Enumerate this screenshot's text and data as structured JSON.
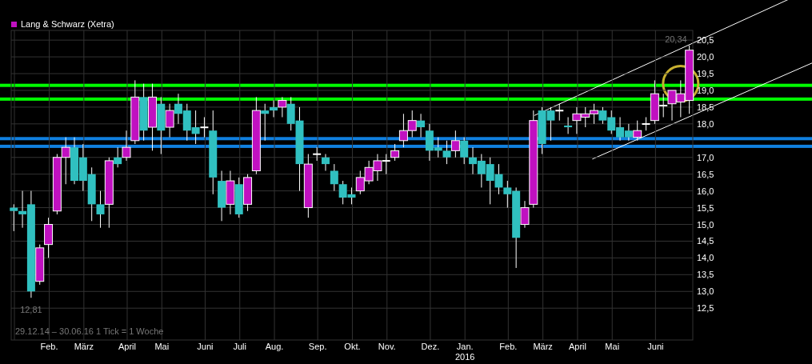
{
  "chart_data": {
    "type": "candlestick",
    "categories": [
      null,
      null,
      null,
      null,
      "Feb.",
      null,
      null,
      null,
      "März",
      null,
      null,
      null,
      null,
      "April",
      null,
      null,
      null,
      "Mai",
      null,
      null,
      null,
      null,
      "Juni",
      null,
      null,
      null,
      "Juli",
      null,
      null,
      null,
      "Aug.",
      null,
      null,
      null,
      null,
      "Sep.",
      null,
      null,
      null,
      "Okt.",
      null,
      null,
      null,
      "Nov.",
      null,
      null,
      null,
      null,
      "Dez.",
      null,
      null,
      null,
      "Jan. 2016",
      null,
      null,
      null,
      null,
      "Feb.",
      null,
      null,
      null,
      "März",
      null,
      null,
      null,
      "April",
      null,
      null,
      null,
      "Mai",
      null,
      null,
      null,
      null,
      "Juni",
      null,
      null,
      null,
      null
    ],
    "ylim": [
      11.55,
      20.79
    ],
    "yticks": [
      {
        "value": 20.5,
        "label": "20,5"
      },
      {
        "value": 20,
        "label": "20,0"
      },
      {
        "value": 19.5,
        "label": "19,5"
      },
      {
        "value": 19,
        "label": "19,0"
      },
      {
        "value": 18.5,
        "label": "18,5"
      },
      {
        "value": 18,
        "label": "18,0"
      },
      {
        "value": 17,
        "label": "17,0"
      },
      {
        "value": 16.5,
        "label": "16,5"
      },
      {
        "value": 16,
        "label": "16,0"
      },
      {
        "value": 15.5,
        "label": "15,5"
      },
      {
        "value": 15,
        "label": "15,0"
      },
      {
        "value": 14.5,
        "label": "14,5"
      },
      {
        "value": 14,
        "label": "14,0"
      },
      {
        "value": 13.5,
        "label": "13,5"
      },
      {
        "value": 13,
        "label": "13,0"
      },
      {
        "value": 12.5,
        "label": "12,5"
      }
    ],
    "grid": true,
    "series": [
      {
        "name": "Lang & Schwarz (Xetra)",
        "ohlc": [
          [
            15.5,
            15.6,
            14.8,
            15.4
          ],
          [
            15.4,
            16.0,
            14.9,
            15.3
          ],
          [
            15.6,
            16.0,
            12.81,
            13.0
          ],
          [
            13.3,
            14.4,
            13.2,
            14.3
          ],
          [
            14.4,
            15.2,
            14.0,
            15.0
          ],
          [
            15.4,
            17.1,
            15.3,
            17.0
          ],
          [
            17.0,
            17.6,
            16.2,
            17.3
          ],
          [
            17.3,
            17.6,
            16.2,
            16.3
          ],
          [
            17.0,
            17.4,
            16.0,
            16.3
          ],
          [
            16.5,
            16.7,
            15.1,
            15.6
          ],
          [
            15.6,
            16.0,
            14.9,
            15.3
          ],
          [
            15.6,
            17.0,
            14.9,
            16.9
          ],
          [
            17.0,
            17.3,
            16.7,
            16.8
          ],
          [
            17.0,
            17.8,
            16.9,
            17.3
          ],
          [
            17.5,
            19.3,
            17.4,
            18.8
          ],
          [
            18.8,
            19.2,
            17.5,
            17.8
          ],
          [
            17.9,
            19.2,
            17.2,
            18.8
          ],
          [
            18.6,
            18.8,
            17.1,
            17.8
          ],
          [
            17.9,
            18.6,
            17.6,
            18.4
          ],
          [
            18.6,
            18.9,
            18.0,
            18.3
          ],
          [
            18.4,
            18.6,
            17.5,
            17.8
          ],
          [
            17.9,
            18.4,
            17.4,
            17.7
          ],
          [
            17.9,
            18.2,
            17.6,
            17.92
          ],
          [
            17.8,
            18.4,
            15.9,
            16.4
          ],
          [
            16.3,
            16.6,
            15.1,
            15.5
          ],
          [
            15.6,
            16.6,
            15.3,
            16.3
          ],
          [
            16.2,
            16.4,
            15.2,
            15.3
          ],
          [
            15.6,
            16.5,
            15.4,
            16.4
          ],
          [
            16.6,
            18.8,
            16.5,
            18.4
          ],
          [
            18.4,
            18.6,
            17.5,
            18.3
          ],
          [
            18.5,
            18.7,
            18.2,
            18.4
          ],
          [
            18.5,
            18.8,
            18.2,
            18.7
          ],
          [
            18.6,
            18.8,
            17.8,
            18.0
          ],
          [
            18.1,
            18.5,
            16.0,
            16.8
          ],
          [
            15.5,
            17.1,
            15.2,
            16.8
          ],
          [
            17.1,
            17.3,
            16.9,
            17.12
          ],
          [
            17.0,
            17.1,
            16.6,
            16.8
          ],
          [
            16.6,
            16.8,
            16.0,
            16.2
          ],
          [
            16.2,
            16.3,
            15.6,
            15.8
          ],
          [
            15.9,
            16.1,
            15.6,
            15.8
          ],
          [
            16.0,
            16.6,
            15.9,
            16.4
          ],
          [
            16.3,
            16.9,
            16.2,
            16.7
          ],
          [
            16.6,
            17.1,
            16.3,
            16.9
          ],
          [
            16.9,
            17.1,
            16.5,
            16.92
          ],
          [
            17.0,
            17.4,
            16.9,
            17.2
          ],
          [
            17.5,
            18.3,
            17.3,
            17.8
          ],
          [
            17.8,
            18.4,
            17.6,
            18.1
          ],
          [
            18.1,
            18.3,
            17.6,
            17.9
          ],
          [
            17.8,
            18.0,
            16.9,
            17.2
          ],
          [
            17.3,
            17.6,
            17.0,
            17.2
          ],
          [
            17.2,
            17.5,
            16.8,
            17.0
          ],
          [
            17.2,
            17.8,
            17.0,
            17.5
          ],
          [
            17.5,
            17.6,
            16.8,
            17.0
          ],
          [
            17.0,
            17.3,
            16.5,
            16.8
          ],
          [
            16.9,
            17.1,
            16.1,
            16.5
          ],
          [
            16.8,
            17.0,
            15.6,
            16.3
          ],
          [
            16.5,
            16.8,
            15.9,
            16.1
          ],
          [
            16.1,
            16.3,
            15.5,
            15.9
          ],
          [
            16.0,
            16.1,
            13.7,
            14.6
          ],
          [
            15.0,
            15.7,
            14.9,
            15.5
          ],
          [
            15.6,
            18.4,
            15.5,
            18.1
          ],
          [
            18.4,
            18.5,
            17.1,
            17.4
          ],
          [
            18.4,
            18.5,
            17.5,
            18.1
          ],
          [
            18.4,
            18.6,
            18.1,
            18.42
          ],
          [
            17.95,
            18.2,
            17.7,
            17.9
          ],
          [
            18.1,
            18.5,
            17.7,
            18.3
          ],
          [
            18.2,
            18.5,
            17.9,
            18.3
          ],
          [
            18.3,
            18.6,
            18.0,
            18.4
          ],
          [
            18.4,
            18.5,
            18.0,
            18.1
          ],
          [
            18.2,
            18.4,
            17.7,
            17.8
          ],
          [
            17.9,
            18.2,
            17.5,
            17.6
          ],
          [
            17.8,
            18.0,
            17.5,
            17.6
          ],
          [
            17.6,
            18.1,
            17.5,
            17.8
          ],
          [
            18.0,
            18.2,
            17.8,
            18.02
          ],
          [
            18.1,
            19.3,
            18.0,
            18.9
          ],
          [
            18.55,
            18.9,
            18.2,
            18.57
          ],
          [
            18.6,
            19.0,
            18.1,
            19.0
          ],
          [
            18.65,
            19.3,
            18.2,
            18.9
          ],
          [
            18.7,
            20.34,
            18.3,
            20.2
          ]
        ]
      }
    ],
    "annotations": [
      "20,34",
      "12,81"
    ]
  },
  "chart_note": "29.12.14 – 30.06.16   1 Tick = 1 Woche",
  "overlays": [
    {
      "kind": "hline",
      "color": "#00ff00"
    },
    {
      "kind": "hline",
      "color": "#00ff00"
    },
    {
      "kind": "hline",
      "color": "#1080e0"
    },
    {
      "kind": "hline",
      "color": "#1080e0"
    },
    {
      "kind": "trendline",
      "color": "#ffffff"
    },
    {
      "kind": "trendline",
      "color": "#ffffff"
    },
    {
      "kind": "circle",
      "color": "#c8b030"
    }
  ]
}
